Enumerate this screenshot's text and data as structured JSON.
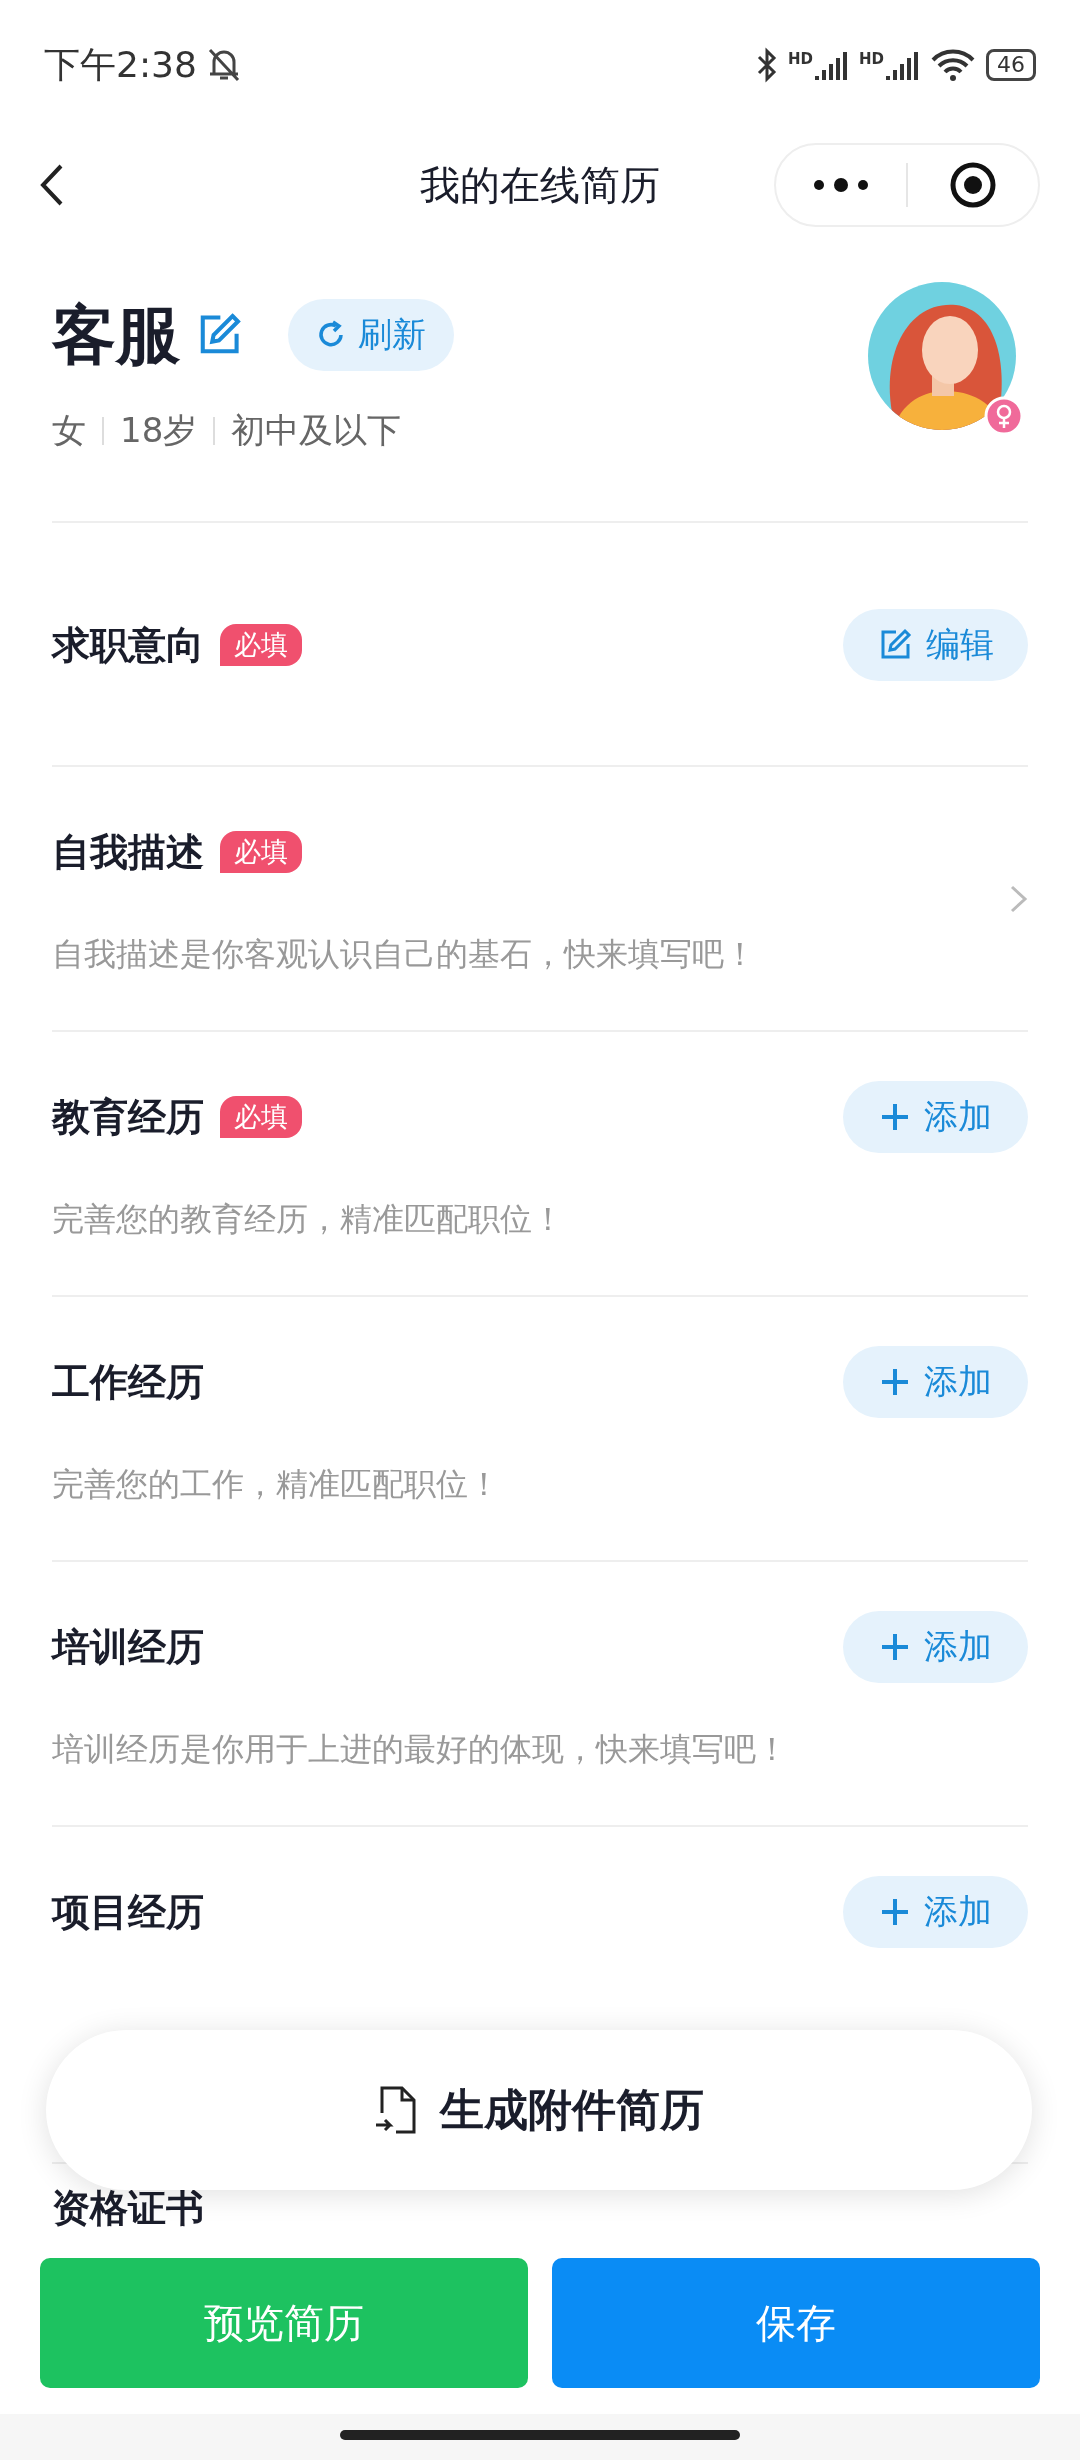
{
  "status_bar": {
    "time": "下午2:38",
    "signals": [
      {
        "label": "HD"
      },
      {
        "label": "HD"
      }
    ],
    "battery": "46"
  },
  "nav": {
    "title": "我的在线简历"
  },
  "profile": {
    "name": "客服",
    "refresh": "刷新",
    "meta": [
      "女",
      "18岁",
      "初中及以下"
    ]
  },
  "sections": [
    {
      "title": "求职意向",
      "badge": "必填",
      "kind": "edit",
      "action": "编辑"
    },
    {
      "title": "自我描述",
      "badge": "必填",
      "kind": "chevron",
      "description": "自我描述是你客观认识自己的基石，快来填写吧！"
    },
    {
      "title": "教育经历",
      "badge": "必填",
      "kind": "add",
      "action": "添加",
      "description": "完善您的教育经历，精准匹配职位！"
    },
    {
      "title": "工作经历",
      "kind": "add",
      "action": "添加",
      "description": "完善您的工作，精准匹配职位！"
    },
    {
      "title": "培训经历",
      "kind": "add",
      "action": "添加",
      "description": "培训经历是你用于上进的最好的体现，快来填写吧！"
    },
    {
      "title": "项目经历",
      "kind": "add",
      "action": "添加"
    },
    {
      "title": "资格证书",
      "kind": "none"
    }
  ],
  "floating_button": "生成附件简历",
  "bottom_buttons": [
    {
      "label": "预览简历",
      "kind": "secondary"
    },
    {
      "label": "保存",
      "kind": "primary"
    }
  ]
}
